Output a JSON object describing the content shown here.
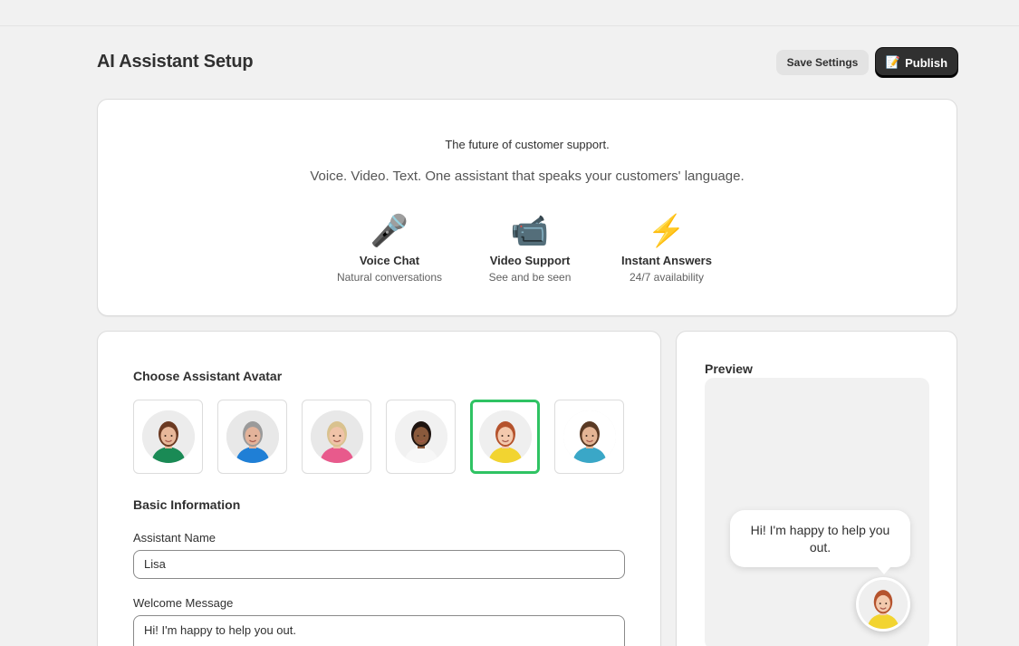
{
  "page": {
    "title": "AI Assistant Setup",
    "save_label": "Save Settings",
    "publish_icon": "📝",
    "publish_label": "Publish"
  },
  "hero": {
    "tagline": "The future of customer support.",
    "subtitle": "Voice. Video. Text. One assistant that speaks your customers' language.",
    "features": [
      {
        "icon": "🎤",
        "icon_name": "microphone-icon",
        "title": "Voice Chat",
        "desc": "Natural conversations"
      },
      {
        "icon": "📹",
        "icon_name": "video-camera-icon",
        "title": "Video Support",
        "desc": "See and be seen"
      },
      {
        "icon": "⚡",
        "icon_name": "lightning-icon",
        "title": "Instant Answers",
        "desc": "24/7 availability"
      }
    ]
  },
  "form": {
    "avatar_section_title": "Choose Assistant Avatar",
    "avatars": [
      {
        "skin": "#e8b89a",
        "hair": "#6b3a22",
        "shirt": "#1a8a55",
        "bg": "#ececec"
      },
      {
        "skin": "#e3b39a",
        "hair": "#9a9a9a",
        "shirt": "#1f7fd6",
        "bg": "#e8e8e8"
      },
      {
        "skin": "#f0c3a8",
        "hair": "#d9c28f",
        "shirt": "#e85a8c",
        "bg": "#e8e8e8"
      },
      {
        "skin": "#8a5a3c",
        "hair": "#1e1410",
        "shirt": "#f7f7f7",
        "bg": "#f1f1f1"
      },
      {
        "skin": "#f3c9ad",
        "hair": "#b5532d",
        "shirt": "#f2d430",
        "bg": "#efefef"
      },
      {
        "skin": "#e4b595",
        "hair": "#5a3a24",
        "shirt": "#3aa7c7",
        "bg": "#ffffff"
      }
    ],
    "selected_avatar_index": 4,
    "basic_info_title": "Basic Information",
    "name_label": "Assistant Name",
    "name_value": "Lisa",
    "welcome_label": "Welcome Message",
    "welcome_value": "Hi! I'm happy to help you out."
  },
  "preview": {
    "title": "Preview",
    "bubble_text": "Hi! I'm happy to help you out."
  },
  "colors": {
    "accent_selected": "#2fc363",
    "primary_button": "#303030"
  }
}
